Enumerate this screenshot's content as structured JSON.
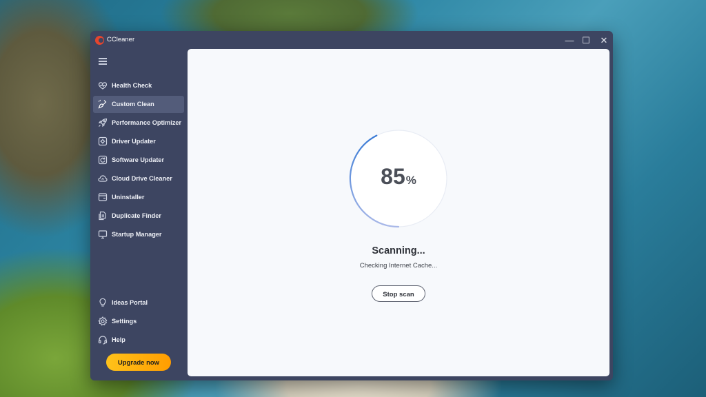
{
  "window": {
    "title": "CCleaner",
    "controls": {
      "minimize": "—",
      "maximize": "☐",
      "close": "✕"
    }
  },
  "sidebar": {
    "menu_icon": "hamburger-icon",
    "items": [
      {
        "label": "Health Check",
        "icon": "heart-icon",
        "active": false
      },
      {
        "label": "Custom Clean",
        "icon": "brush-icon",
        "active": true
      },
      {
        "label": "Performance Optimizer",
        "icon": "rocket-icon",
        "active": false
      },
      {
        "label": "Driver Updater",
        "icon": "gear-box-icon",
        "active": false
      },
      {
        "label": "Software Updater",
        "icon": "refresh-box-icon",
        "active": false
      },
      {
        "label": "Cloud Drive Cleaner",
        "icon": "cloud-icon",
        "active": false
      },
      {
        "label": "Uninstaller",
        "icon": "uninstall-icon",
        "active": false
      },
      {
        "label": "Duplicate Finder",
        "icon": "duplicate-icon",
        "active": false
      },
      {
        "label": "Startup Manager",
        "icon": "monitor-icon",
        "active": false
      }
    ],
    "bottom_items": [
      {
        "label": "Ideas Portal",
        "icon": "lightbulb-icon"
      },
      {
        "label": "Settings",
        "icon": "gear-icon"
      },
      {
        "label": "Help",
        "icon": "help-icon"
      }
    ],
    "upgrade_label": "Upgrade now"
  },
  "scan": {
    "progress": 85,
    "progress_value": "85",
    "percent_sign": "%",
    "title": "Scanning...",
    "subtitle": "Checking Internet Cache...",
    "stop_label": "Stop scan"
  },
  "colors": {
    "sidebar_bg": "#3d4561",
    "active_item": "#535c7a",
    "content_bg": "#f7f9fc",
    "progress_accent": "#3a7bd5",
    "upgrade_button": "#ffb20f",
    "logo_red": "#e4452e"
  }
}
